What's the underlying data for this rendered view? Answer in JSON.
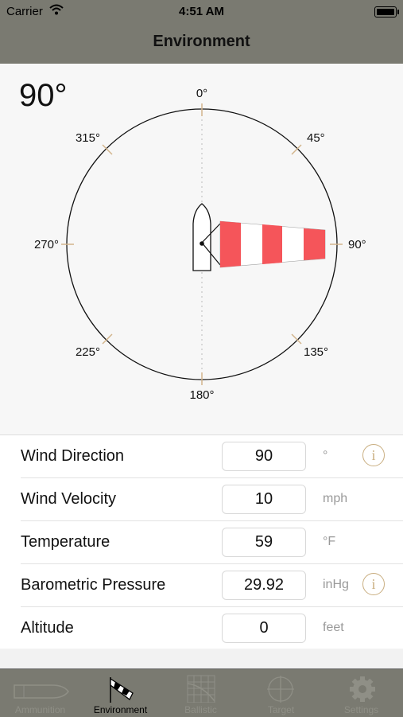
{
  "status_bar": {
    "carrier": "Carrier",
    "time": "4:51 AM"
  },
  "nav": {
    "title": "Environment"
  },
  "compass": {
    "heading": "90°",
    "wind_direction_deg": 90,
    "labels": {
      "n": "0°",
      "ne": "45°",
      "e": "90°",
      "se": "135°",
      "s": "180°",
      "sw": "225°",
      "w": "270°",
      "nw": "315°"
    },
    "sock_colors": {
      "stripe": "#f5555a",
      "band": "#ffffff"
    },
    "tick_color": "#d2b48c"
  },
  "form": {
    "rows": [
      {
        "label": "Wind Direction",
        "value": "90",
        "unit": "°",
        "info": "i"
      },
      {
        "label": "Wind Velocity",
        "value": "10",
        "unit": "mph"
      },
      {
        "label": "Temperature",
        "value": "59",
        "unit": "°F"
      },
      {
        "label": "Barometric Pressure",
        "value": "29.92",
        "unit": "inHg",
        "info": "i"
      },
      {
        "label": "Altitude",
        "value": "0",
        "unit": "feet"
      }
    ]
  },
  "tabs": [
    {
      "label": "Ammunition",
      "icon": "bullet-icon"
    },
    {
      "label": "Environment",
      "icon": "windsock-icon",
      "active": true
    },
    {
      "label": "Ballistic",
      "icon": "ballistic-chart-icon"
    },
    {
      "label": "Target",
      "icon": "crosshair-icon"
    },
    {
      "label": "Settings",
      "icon": "gear-icon"
    }
  ]
}
